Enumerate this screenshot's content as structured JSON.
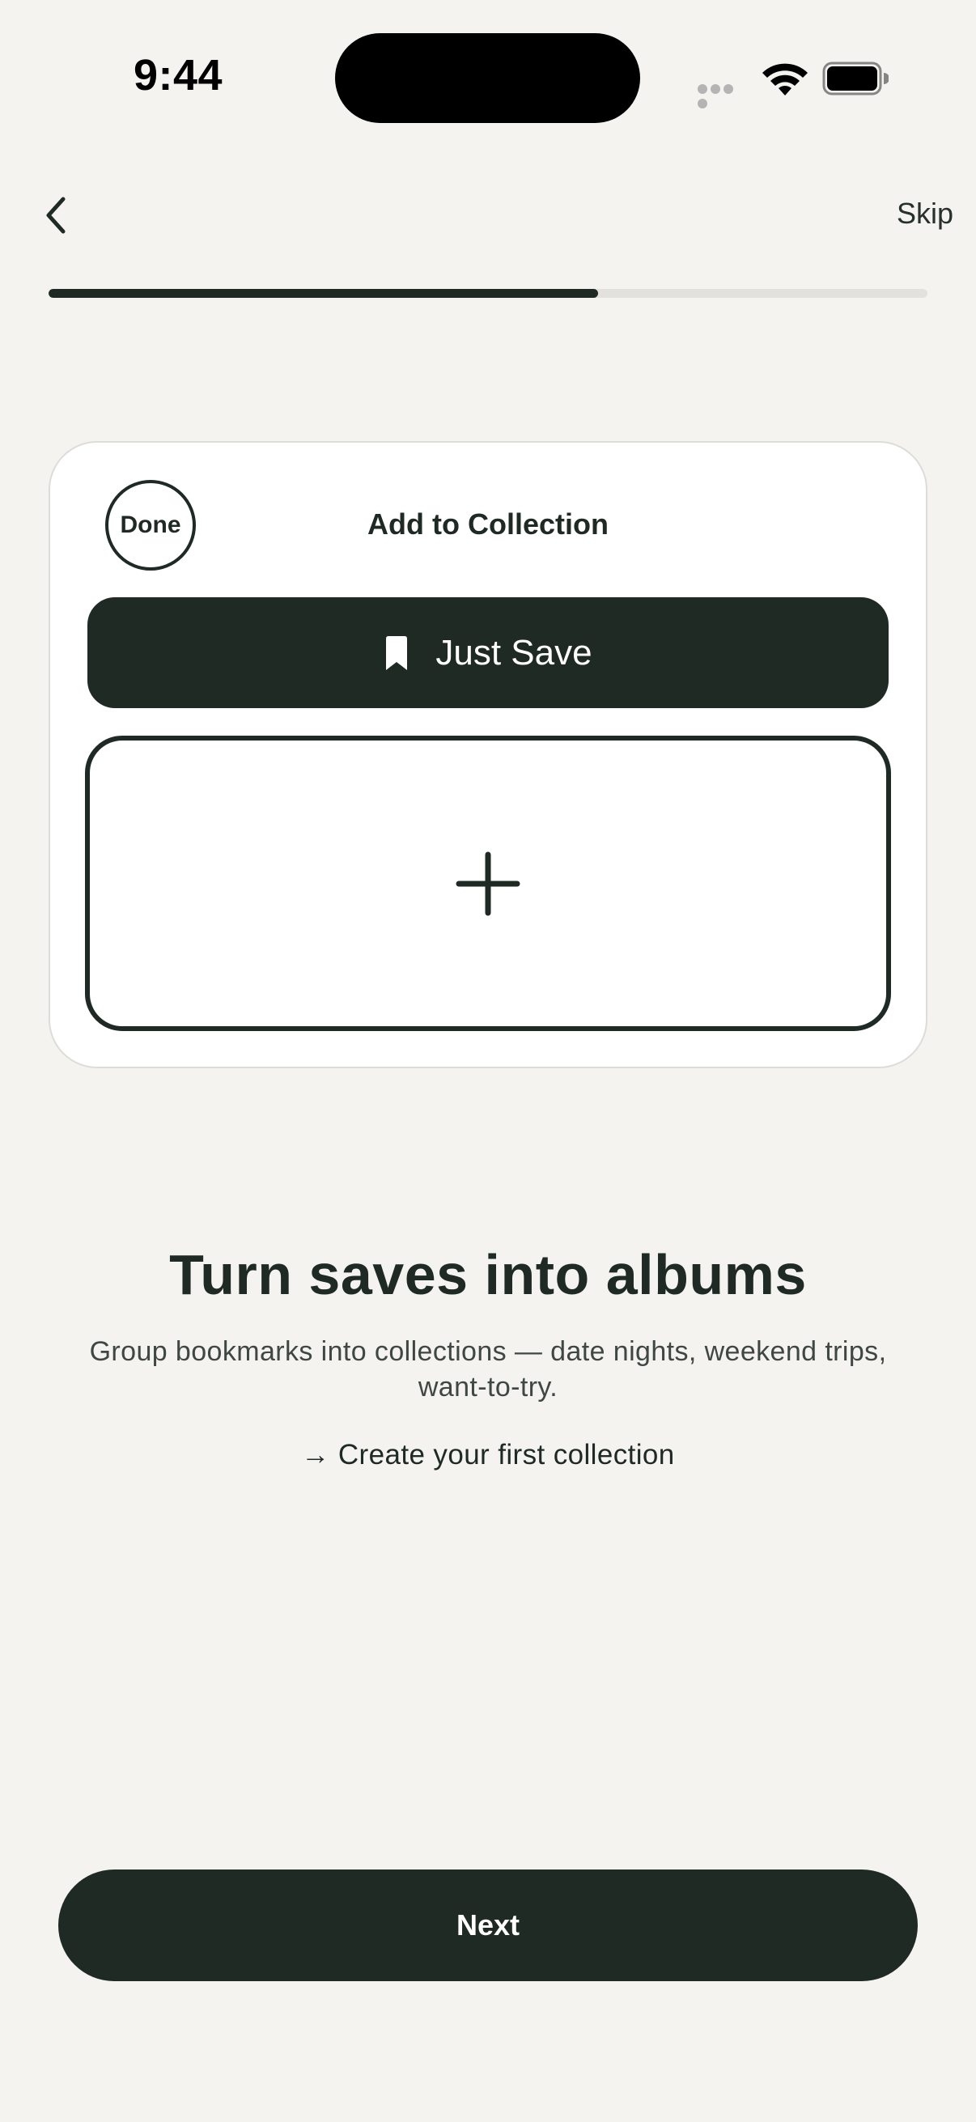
{
  "status_bar": {
    "time": "9:44",
    "signal_icon": "signal-dots-icon",
    "wifi_icon": "wifi-icon",
    "battery_icon": "battery-icon"
  },
  "nav": {
    "back_icon": "chevron-left-icon",
    "skip_label": "Skip",
    "progress": 0.625
  },
  "card": {
    "done_label": "Done",
    "title": "Add to Collection",
    "just_save_label": "Just Save",
    "just_save_icon": "bookmark-icon",
    "add_icon": "plus-icon"
  },
  "content": {
    "headline": "Turn saves into albums",
    "description": "Group bookmarks into collections — date nights, weekend trips, want-to-try.",
    "cta": "→ Create your first collection"
  },
  "footer": {
    "next_label": "Next"
  },
  "colors": {
    "background": "#f4f3f0",
    "primary": "#1f2a25",
    "card": "#ffffff",
    "track": "#e2e1dd"
  }
}
